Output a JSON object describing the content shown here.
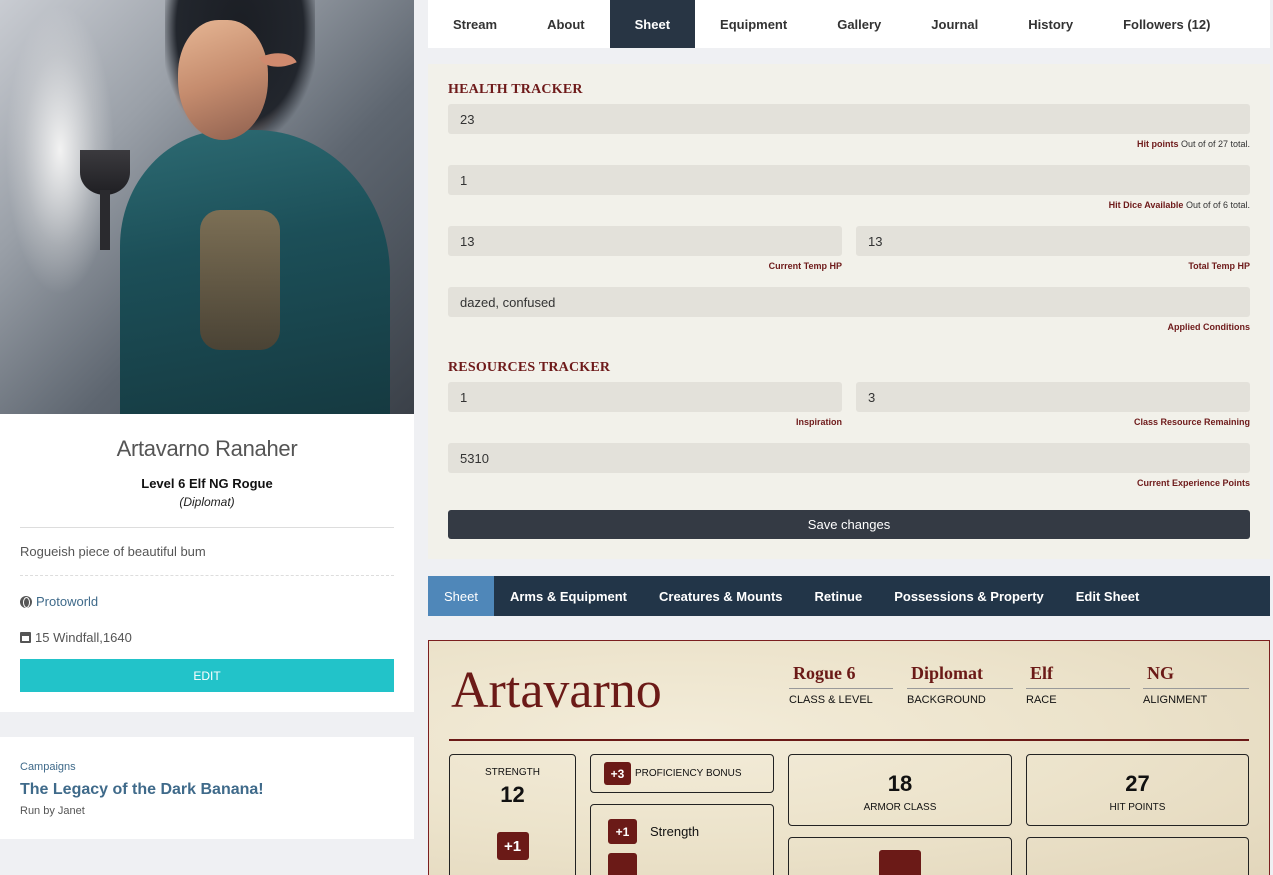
{
  "profile": {
    "name": "Artavarno Ranaher",
    "subtitle": "Level 6 Elf NG Rogue",
    "archetype": "(Diplomat)",
    "bio": "Rogueish piece of beautiful bum",
    "world_link": "Protoworld",
    "date": "15 Windfall,1640",
    "edit_label": "EDIT"
  },
  "campaign": {
    "label": "Campaigns",
    "title": "The Legacy of the Dark Banana!",
    "run_by": "Run by Janet"
  },
  "tabs": [
    "Stream",
    "About",
    "Sheet",
    "Equipment",
    "Gallery",
    "Journal",
    "History",
    "Followers (12)"
  ],
  "health": {
    "title": "HEALTH TRACKER",
    "hp": "23",
    "hp_hint_label": "Hit points",
    "hp_hint_rest": " Out of of 27 total.",
    "hit_dice": "1",
    "hd_hint_label": "Hit Dice Available",
    "hd_hint_rest": " Out of of 6 total.",
    "current_temp": "13",
    "current_temp_label": "Current Temp HP",
    "total_temp": "13",
    "total_temp_label": "Total Temp HP",
    "conditions": "dazed, confused",
    "conditions_label": "Applied Conditions"
  },
  "resources": {
    "title": "RESOURCES TRACKER",
    "inspiration": "1",
    "inspiration_label": "Inspiration",
    "class_resource": "3",
    "class_resource_label": "Class Resource Remaining",
    "xp": "5310",
    "xp_label": "Current Experience Points"
  },
  "save_label": "Save changes",
  "subtabs": [
    "Sheet",
    "Arms & Equipment",
    "Creatures & Mounts",
    "Retinue",
    "Possessions & Property",
    "Edit Sheet"
  ],
  "sheet": {
    "name": "Artavarno",
    "class_level": "Rogue 6",
    "class_level_label": "CLASS & LEVEL",
    "background": "Diplomat",
    "background_label": "BACKGROUND",
    "race": "Elf",
    "race_label": "RACE",
    "alignment": "NG",
    "alignment_label": "ALIGNMENT",
    "strength_label": "STRENGTH",
    "strength": "12",
    "strength_mod": "+1",
    "prof_bonus": "+3",
    "prof_label": "PROFICIENCY BONUS",
    "save_mod": "+1",
    "save_name": "Strength",
    "armor_class": "18",
    "armor_class_label": "ARMOR CLASS",
    "hit_points": "27",
    "hit_points_label": "HIT POINTS"
  },
  "colors": {
    "accent_teal": "#22c3c9",
    "nav_dark": "#283544",
    "sheet_red": "#6b1a17",
    "subnav_active": "#4f87b9"
  }
}
